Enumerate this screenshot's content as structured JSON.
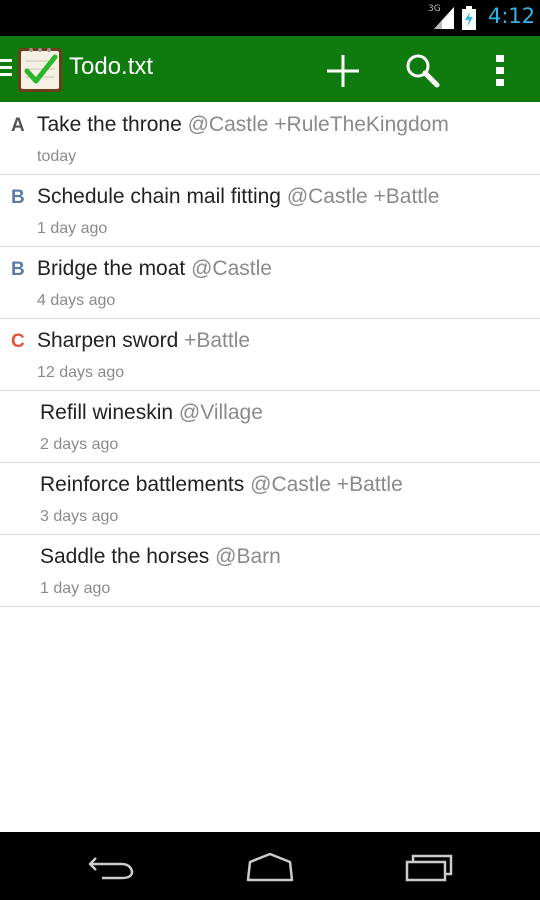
{
  "status_bar": {
    "network": "3G",
    "time": "4:12",
    "accent_color": "#33b5e5"
  },
  "action_bar": {
    "title": "Todo.txt",
    "background_color": "#0f7b0f",
    "icons": [
      "drawer-icon",
      "app-logo-icon",
      "add-icon",
      "search-icon",
      "overflow-menu-icon"
    ]
  },
  "tasks": [
    {
      "priority": "A",
      "priority_color": "#555555",
      "text": "Take the throne",
      "tags": "@Castle +RuleTheKingdom",
      "date": "today"
    },
    {
      "priority": "B",
      "priority_color": "#5b7aa8",
      "text": "Schedule chain mail fitting",
      "tags": "@Castle +Battle",
      "date": "1 day ago"
    },
    {
      "priority": "B",
      "priority_color": "#5b7aa8",
      "text": "Bridge the moat",
      "tags": "@Castle",
      "date": "4 days ago"
    },
    {
      "priority": "C",
      "priority_color": "#e0543b",
      "text": "Sharpen sword",
      "tags": "+Battle",
      "date": "12 days ago"
    },
    {
      "priority": "",
      "text": "Refill wineskin",
      "tags": "@Village",
      "date": "2 days ago"
    },
    {
      "priority": "",
      "text": "Reinforce battlements",
      "tags": "@Castle +Battle",
      "date": "3 days ago"
    },
    {
      "priority": "",
      "text": "Saddle the horses",
      "tags": "@Barn",
      "date": "1 day ago"
    }
  ],
  "nav_bar": {
    "icons": [
      "back-icon",
      "home-icon",
      "recents-icon"
    ]
  }
}
